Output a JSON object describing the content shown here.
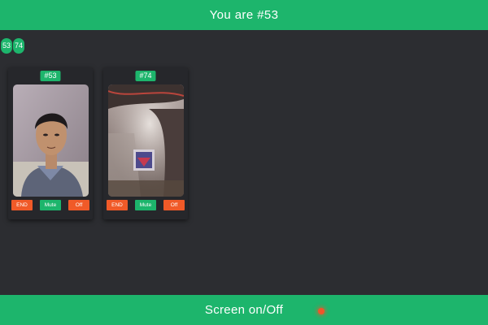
{
  "header": {
    "title": "You are #53"
  },
  "peers": [
    "53",
    "74"
  ],
  "cards": [
    {
      "tag": "#53",
      "buttons": {
        "end": "END",
        "mute": "Mute",
        "off": "Off"
      }
    },
    {
      "tag": "#74",
      "buttons": {
        "end": "END",
        "mute": "Mute",
        "off": "Off"
      }
    }
  ],
  "footer": {
    "label": "Screen on/Off"
  },
  "colors": {
    "accent": "#1db56c",
    "danger": "#f05a28",
    "background": "#2c2d31",
    "card": "#26272b"
  }
}
